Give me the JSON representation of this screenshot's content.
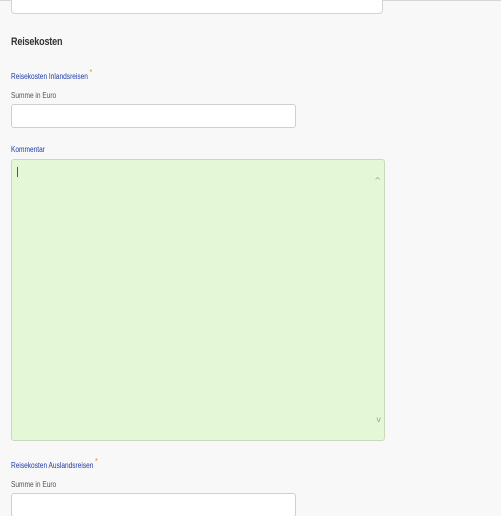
{
  "section": {
    "title": "Reisekosten"
  },
  "fields": {
    "inland": {
      "label": "Reisekosten Inlandsreisen",
      "required_marker": "*",
      "hint": "Summe in Euro",
      "value": ""
    },
    "comment": {
      "label": "Kommentar",
      "value": ""
    },
    "ausland": {
      "label": "Reisekosten Auslandsreisen",
      "required_marker": "*",
      "hint": "Summe in Euro",
      "value": ""
    }
  },
  "scroll": {
    "up_icon": "^",
    "down_icon": "v"
  },
  "colors": {
    "label_blue": "#1e3aa8",
    "required_orange": "#e08a1e",
    "textarea_green": "#e4f8d8"
  }
}
